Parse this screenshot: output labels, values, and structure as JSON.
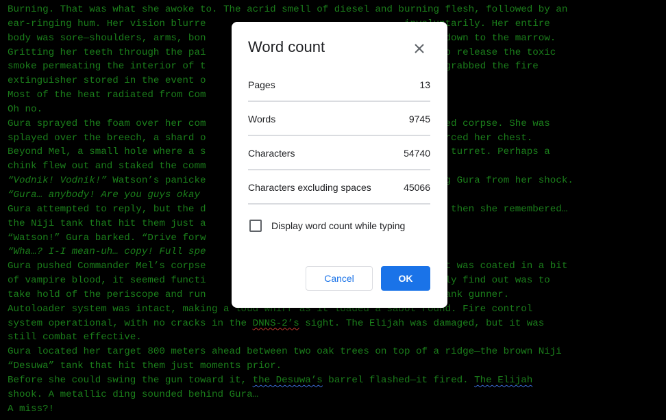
{
  "document": {
    "lines": [
      [
        {
          "t": "Burning. That was what she awoke to. The acrid smell of diesel and burning flesh, followed by an"
        }
      ],
      [
        {
          "t": "ear-ringing hum. Her vision blurre                                  involuntarily. Her entire"
        }
      ],
      [
        {
          "t": "body was sore—shoulders, arms, bon                                   right down to the marrow."
        }
      ],
      [
        {
          "t": "Gritting her teeth through the pai                                   atch to release the toxic"
        }
      ],
      [
        {
          "t": "smoke permeating the interior of t                                   e and grabbed the fire"
        }
      ],
      [
        {
          "t": "extinguisher stored in the event o"
        }
      ],
      [
        {
          "t": "Most of the heat radiated from Com"
        }
      ],
      [
        {
          "t": "Oh no."
        }
      ],
      [
        {
          "t": "Gura sprayed the foam over her com                                   bloodied corpse. She was"
        }
      ],
      [
        {
          "t": "splayed over the breech, a shard o                                   m, pierced her chest."
        }
      ],
      [
        {
          "t": "Beyond Mel, a small hole where a s                                   tank’s turret. Perhaps a"
        }
      ],
      [
        {
          "t": "chink flew out and staked the comm"
        }
      ],
      [
        {
          "t": "“Vodnik! Vodnik!”",
          "s": "it"
        },
        {
          "t": " Watson’s panicke                                   pulling Gura from her shock."
        }
      ],
      [
        {
          "t": "“Gura… anybody! Are you guys okay",
          "s": "it"
        }
      ],
      [
        {
          "t": "Gura attempted to reply, but the d                                   It was then she remembered…"
        }
      ],
      [
        {
          "t": "the Niji tank that hit them just a"
        }
      ],
      [
        {
          "t": "“Watson!” Gura barked. “Drive forw"
        }
      ],
      [
        {
          "t": "“Wha…? I-I mean-uh… copy! Full spe",
          "s": "it"
        }
      ],
      [
        {
          "t": "Gura pushed Commander Mel’s corpse                                   ough it was coated in a bit"
        }
      ],
      [
        {
          "t": "of vampire blood, it seemed functi                                   to truly find out was to"
        }
      ],
      [
        {
          "t": "take hold of the periscope and run                                   of a tank gunner."
        }
      ],
      [
        {
          "t": "Autoloader system was intact, making a loud whirr as it loaded a sabot round. Fire control"
        }
      ],
      [
        {
          "t": "system operational, with no cracks in the "
        },
        {
          "t": "DNNS-2’s",
          "s": "sq"
        },
        {
          "t": " sight. The Elijah was damaged, but it was"
        }
      ],
      [
        {
          "t": "still combat effective."
        }
      ],
      [
        {
          "t": "Gura located her target 800 meters ahead between two oak trees on top of a ridge—the brown Niji"
        }
      ],
      [
        {
          "t": "“Desuwa” tank that hit them just moments prior."
        }
      ],
      [
        {
          "t": "Before she could swing the gun toward it, "
        },
        {
          "t": "the Desuwa’s",
          "s": "sqb"
        },
        {
          "t": " barrel flashed—it fired. "
        },
        {
          "t": "The Elijah",
          "s": "sqb"
        }
      ],
      [
        {
          "t": "shook. A metallic ding sounded behind Gura…"
        }
      ],
      [
        {
          "t": "A miss?!"
        }
      ]
    ]
  },
  "dialog": {
    "title": "Word count",
    "close_icon": "close-icon",
    "stats": [
      {
        "label": "Pages",
        "value": "13"
      },
      {
        "label": "Words",
        "value": "9745"
      },
      {
        "label": "Characters",
        "value": "54740"
      },
      {
        "label": "Characters excluding spaces",
        "value": "45066"
      }
    ],
    "checkbox_label": "Display word count while typing",
    "checkbox_checked": false,
    "cancel_label": "Cancel",
    "ok_label": "OK"
  },
  "colors": {
    "text_green": "#1b7f1b",
    "background": "#000000",
    "accent_blue": "#1a73e8"
  }
}
